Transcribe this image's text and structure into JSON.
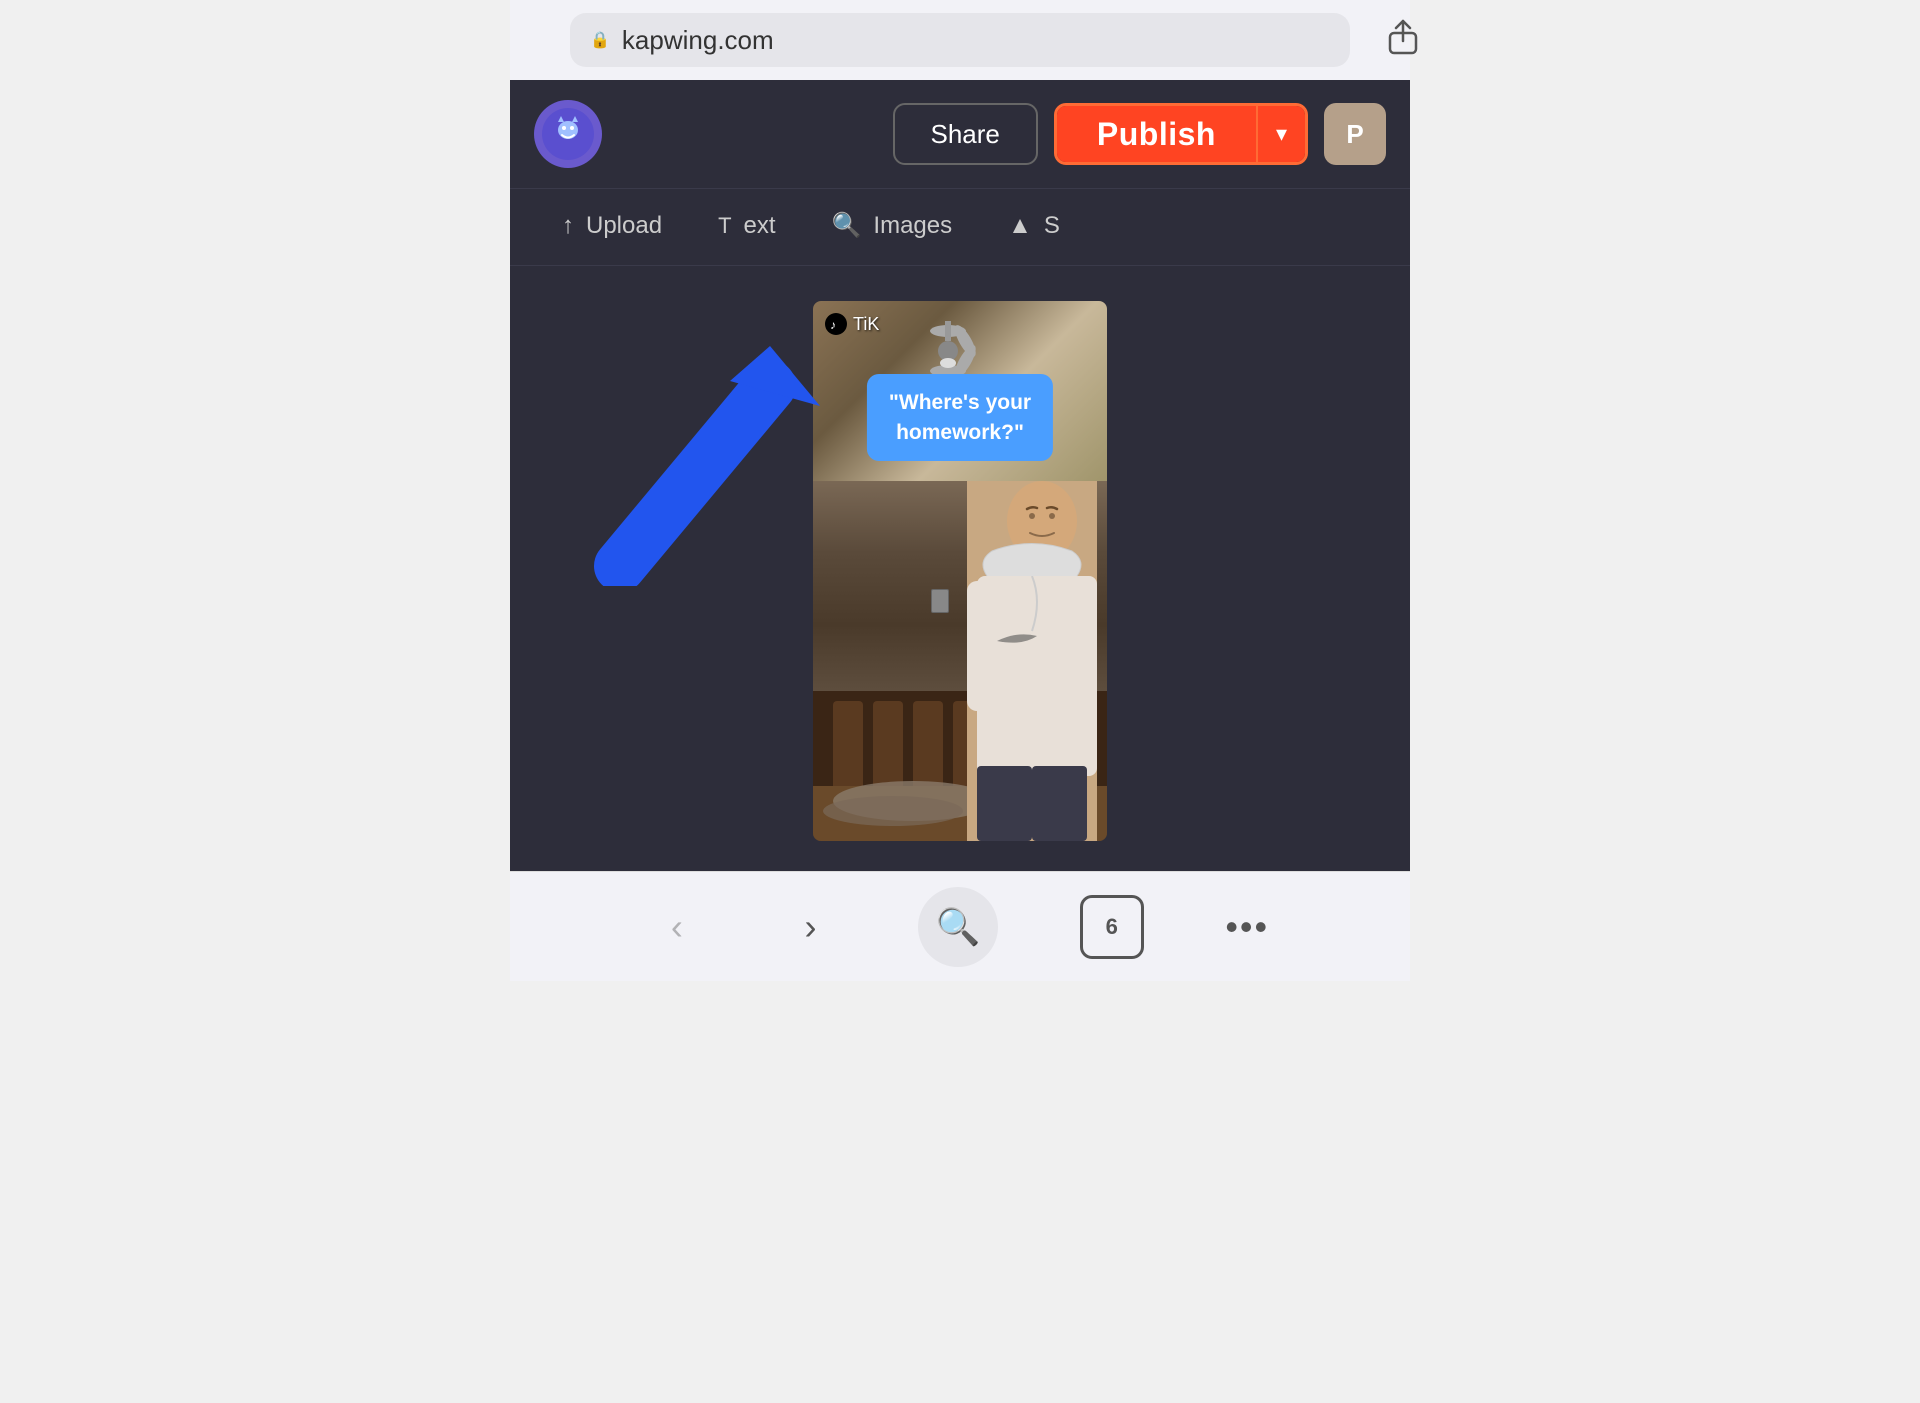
{
  "browser": {
    "url": "kapwing.com",
    "lock_icon": "🔒",
    "share_icon": "⬆",
    "back_icon": "‹",
    "forward_icon": "›",
    "search_icon": "🔍",
    "tabs_count": "6",
    "more_icon": "···"
  },
  "toolbar": {
    "share_label": "Share",
    "publish_label": "Publish",
    "publish_dropdown_icon": "▾",
    "user_initial": "P"
  },
  "secondary_toolbar": {
    "upload_label": "Upload",
    "text_label": "ext",
    "images_label": "Images",
    "subtitle_label": "S"
  },
  "video": {
    "tiktok_label": "TiK",
    "text_bubble_line1": "\"Where's your",
    "text_bubble_line2": "homework?\""
  },
  "arrow": {
    "description": "blue arrow pointing upper-right"
  },
  "colors": {
    "app_bg": "#2d2d3a",
    "publish_red": "#ff4422",
    "publish_border": "#ff6b35",
    "text_bubble_blue": "#4a9eff",
    "browser_bg": "#f2f2f7"
  }
}
